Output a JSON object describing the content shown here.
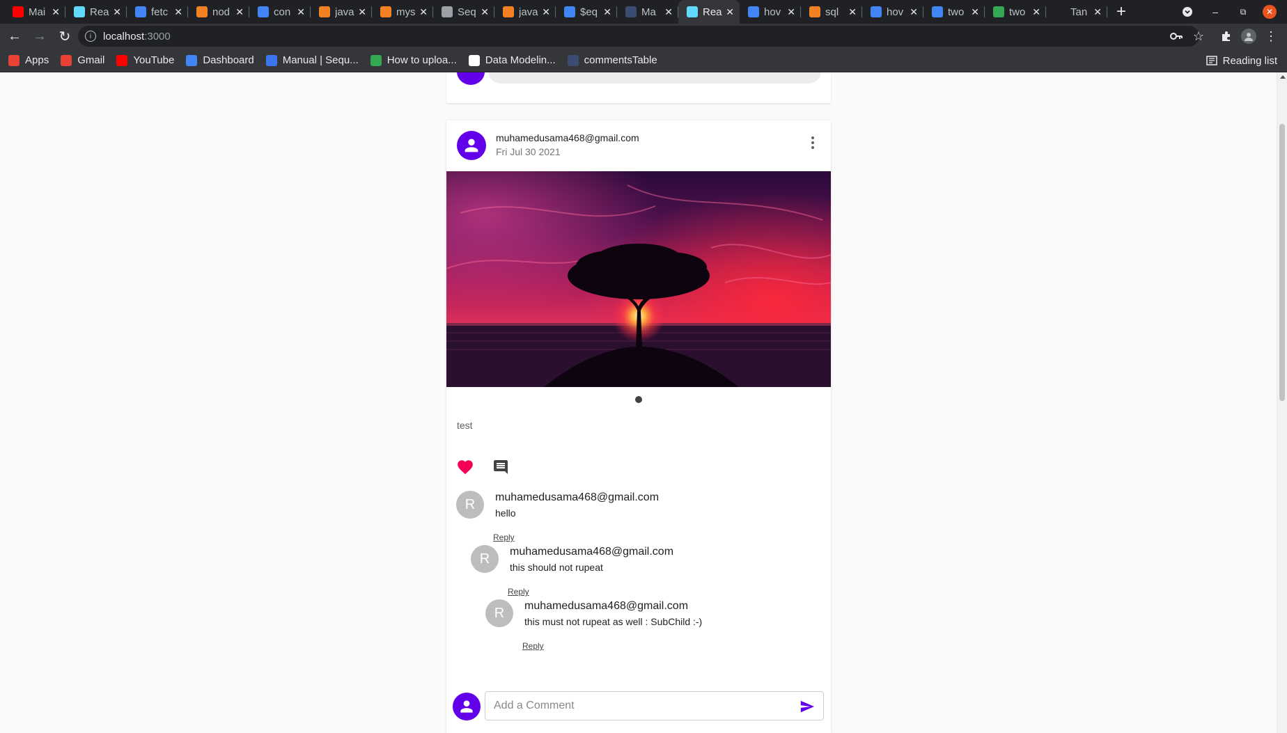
{
  "browser": {
    "tabs": [
      {
        "label": "Mai",
        "icon": "youtube-icon",
        "color": "#ff0000"
      },
      {
        "label": "Rea",
        "icon": "react-icon",
        "color": "#61dafb"
      },
      {
        "label": "fetc",
        "icon": "google-icon",
        "color": "#4285f4"
      },
      {
        "label": "nod",
        "icon": "stackoverflow-icon",
        "color": "#f48024"
      },
      {
        "label": "con",
        "icon": "google-icon",
        "color": "#4285f4"
      },
      {
        "label": "java",
        "icon": "stackoverflow-icon",
        "color": "#f48024"
      },
      {
        "label": "mys",
        "icon": "stackoverflow-icon",
        "color": "#f48024"
      },
      {
        "label": "Seq",
        "icon": "code-icon",
        "color": "#9aa0a6"
      },
      {
        "label": "java",
        "icon": "stackoverflow-icon",
        "color": "#f48024"
      },
      {
        "label": "$eq",
        "icon": "google-icon",
        "color": "#4285f4"
      },
      {
        "label": "Ma",
        "icon": "sequelize-icon",
        "color": "#3b4b72"
      },
      {
        "label": "Rea",
        "icon": "react-icon",
        "color": "#61dafb",
        "active": true
      },
      {
        "label": "hov",
        "icon": "google-icon",
        "color": "#4285f4"
      },
      {
        "label": "sql",
        "icon": "stackoverflow-icon",
        "color": "#f48024"
      },
      {
        "label": "hov",
        "icon": "google-icon",
        "color": "#4285f4"
      },
      {
        "label": "two",
        "icon": "google-icon",
        "color": "#4285f4"
      },
      {
        "label": "two",
        "icon": "leaf-icon",
        "color": "#34a853"
      },
      {
        "label": "Tan",
        "icon": "github-icon",
        "color": "#202124"
      }
    ],
    "address": {
      "host": "localhost",
      "port": ":3000"
    },
    "bookmarks": [
      {
        "label": "Apps",
        "icon": "apps-grid-icon",
        "color": "#ea4335"
      },
      {
        "label": "Gmail",
        "icon": "gmail-icon",
        "color": "#ea4335"
      },
      {
        "label": "YouTube",
        "icon": "youtube-icon",
        "color": "#ff0000"
      },
      {
        "label": "Dashboard",
        "icon": "google-icon",
        "color": "#4285f4"
      },
      {
        "label": "Manual | Sequ...",
        "icon": "sequelize-icon",
        "color": "#3b76f0"
      },
      {
        "label": "How to uploa...",
        "icon": "green-circle-icon",
        "color": "#34a853"
      },
      {
        "label": "Data Modelin...",
        "icon": "dev-icon",
        "color": "#ffffff"
      },
      {
        "label": "commentsTable",
        "icon": "codesandbox-icon",
        "color": "#3b4b72"
      }
    ],
    "reading_list": "Reading list"
  },
  "post": {
    "user": "muhamedusama468@gmail.com",
    "date": "Fri Jul 30 2021",
    "caption": "test",
    "liked": true,
    "like_color": "#f50057",
    "accent": "#6200ea"
  },
  "comments": [
    {
      "initial": "R",
      "user": "muhamedusama468@gmail.com",
      "text": "hello",
      "reply": "Reply"
    },
    {
      "initial": "R",
      "user": "muhamedusama468@gmail.com",
      "text": "this should not rupeat",
      "reply": "Reply"
    },
    {
      "initial": "R",
      "user": "muhamedusama468@gmail.com",
      "text": "this must not rupeat as well : SubChild :-)",
      "reply": "Reply"
    }
  ],
  "add_comment": {
    "placeholder": "Add a Comment",
    "value": ""
  }
}
